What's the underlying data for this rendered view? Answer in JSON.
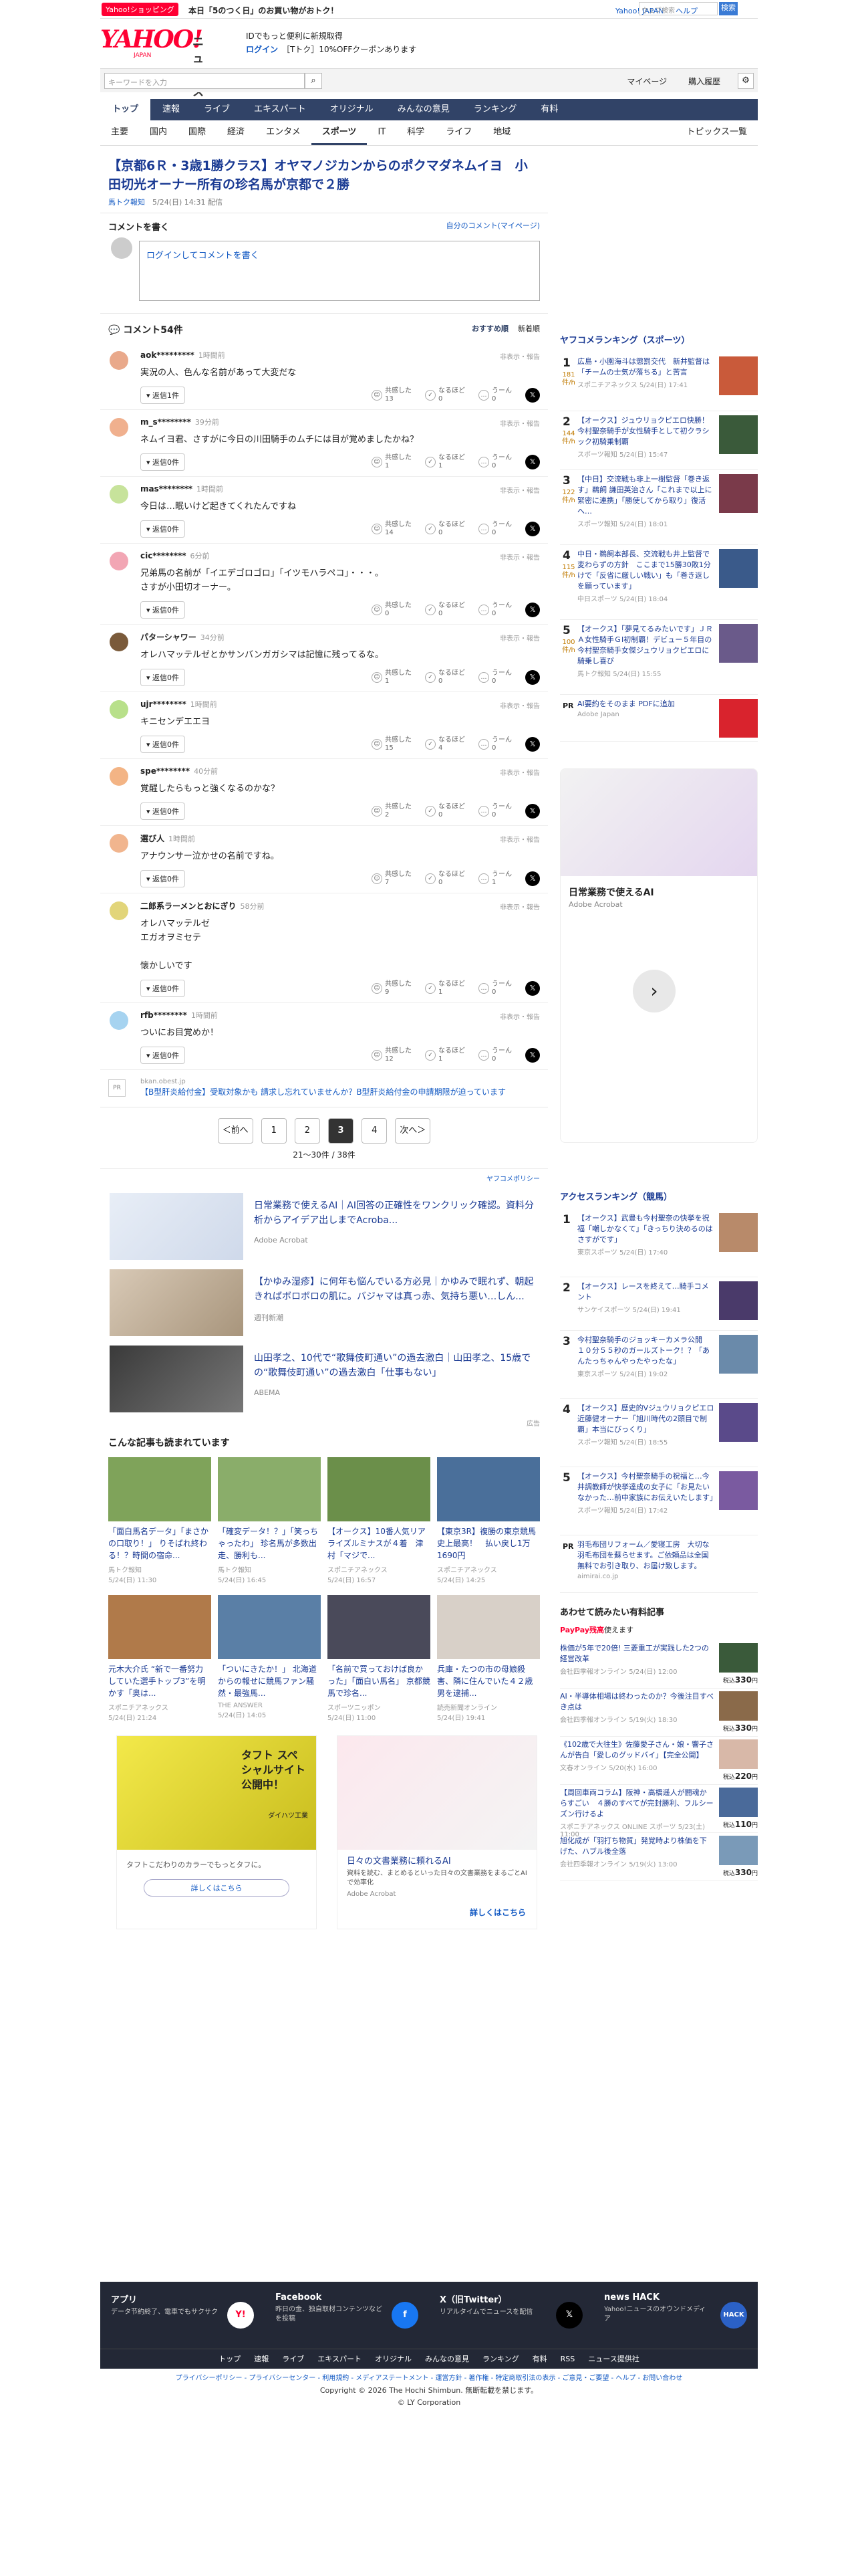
{
  "top": {
    "shopping_badge": "Yahoo!ショッピング",
    "promo": "本日「5のつく日」のお買い物がおトク！",
    "links": [
      "Yahoo! JAPAN",
      "ヘルプ"
    ],
    "web_search_placeholder": "ウェブ検索",
    "web_search_button": "検索"
  },
  "logo": {
    "yahoo": "YAHOO!",
    "japan": "JAPAN",
    "news": "ニュース"
  },
  "login": {
    "line1": "IDでもっと便利に新規取得",
    "line2_login": "ログイン",
    "line2_rest": "［Tトク］10%OFFクーポンあります"
  },
  "search": {
    "placeholder": "キーワードを入力",
    "mypage": "マイページ",
    "purchase": "購入履歴"
  },
  "gnav": [
    "トップ",
    "速報",
    "ライブ",
    "エキスパート",
    "オリジナル",
    "みんなの意見",
    "ランキング",
    "有料"
  ],
  "snav": [
    "主要",
    "国内",
    "国際",
    "経済",
    "エンタメ",
    "スポーツ",
    "IT",
    "科学",
    "ライフ",
    "地域"
  ],
  "snav_topics": "トピックス一覧",
  "article": {
    "title": "【京都6Ｒ・3歳1勝クラス】オヤマノジカンからのポクマダネムイヨ　小田切光オーナー所有の珍名馬が京都で２勝",
    "source": "馬トク報知",
    "date": "5/24(日) 14:31 配信"
  },
  "comment_write": {
    "heading": "コメントを書く",
    "mine": "自分のコメント(マイページ)",
    "login_link": "ログイン",
    "prompt": "してコメントを書く"
  },
  "comments_header": {
    "count": "コメント54件",
    "sort_recommended": "おすすめ順",
    "sort_new": "新着順"
  },
  "comments": [
    {
      "user": "aok*********",
      "time": "1時間前",
      "text": "実況の人、色んな名前があって大変だな",
      "replies": "返信1件",
      "empathy": "13",
      "naruhodo": "0",
      "umu": "0"
    },
    {
      "user": "m_s********",
      "time": "39分前",
      "text": "ネムイヨ君、さすがに今日の川田騎手のムチには目が覚めましたかね？",
      "replies": "返信0件",
      "empathy": "1",
      "naruhodo": "1",
      "umu": "0"
    },
    {
      "user": "mas********",
      "time": "1時間前",
      "text": "今日は…眠いけど起きてくれたんですね",
      "replies": "返信0件",
      "empathy": "14",
      "naruhodo": "0",
      "umu": "0"
    },
    {
      "user": "cic********",
      "time": "6分前",
      "text": "兄弟馬の名前が「イエデゴロゴロ」「イツモハラペコ」・・・。\nさすが小田切オーナー。",
      "replies": "返信0件",
      "empathy": "0",
      "naruhodo": "0",
      "umu": "0"
    },
    {
      "user": "パターシャワー",
      "time": "34分前",
      "text": "オレハマッテルゼとかサンバンガガシマは記憶に残ってるな。",
      "replies": "返信0件",
      "empathy": "1",
      "naruhodo": "0",
      "umu": "0"
    },
    {
      "user": "ujr********",
      "time": "1時間前",
      "text": "キニセンデエエヨ",
      "replies": "返信0件",
      "empathy": "15",
      "naruhodo": "4",
      "umu": "0"
    },
    {
      "user": "spe********",
      "time": "40分前",
      "text": "覚醒したらもっと強くなるのかな？",
      "replies": "返信0件",
      "empathy": "2",
      "naruhodo": "0",
      "umu": "0"
    },
    {
      "user": "選び人",
      "time": "1時間前",
      "text": "アナウンサー泣かせの名前ですね。",
      "replies": "返信0件",
      "empathy": "7",
      "naruhodo": "0",
      "umu": "1"
    },
    {
      "user": "二郎系ラーメンとおにぎり",
      "time": "58分前",
      "text": "オレハマッテルゼ\nエガオヲミセテ\n\n懐かしいです",
      "replies": "返信0件",
      "empathy": "9",
      "naruhodo": "1",
      "umu": "0"
    },
    {
      "user": "rfb********",
      "time": "1時間前",
      "text": "ついにお目覚めか！",
      "replies": "返信0件",
      "empathy": "12",
      "naruhodo": "1",
      "umu": "0"
    }
  ],
  "comment_labels": {
    "report": "非表示・報告",
    "empathy": "共感した",
    "naruhodo": "なるほど",
    "umu": "うーん"
  },
  "ad_text": {
    "pr": "PR",
    "domain": "bkan.obest.jp",
    "message": "【B型肝炎給付金】受取対象かも 請求し忘れていませんか？B型肝炎給付金の申請期限が迫っています"
  },
  "pager": {
    "prev": "＜前へ",
    "pages": [
      "1",
      "2",
      "3",
      "4"
    ],
    "current": "3",
    "next": "次へ＞",
    "count": "21〜30件 / 38件"
  },
  "native_ads": {
    "policy": "ヤフコメポリシー",
    "items": [
      {
        "title": "日常業務で使えるAI｜AI回答の正確性をワンクリック確認。資料分析からアイデア出しまでAcroba...",
        "sponsor": "Adobe Acrobat"
      },
      {
        "title": "【かゆみ湿疹】に何年も悩んでいる方必見｜かゆみで眠れず、朝起きればボロボロの肌に。バジャマは真っ赤、気持ち悪い…しん...",
        "sponsor": "週刊新潮"
      },
      {
        "title": "山田孝之、10代で“歌舞伎町通い”の過去激白｜山田孝之、15歳での“歌舞伎町通い”の過去激白「仕事もない」",
        "sponsor": "ABEMA"
      }
    ]
  },
  "related": {
    "heading": "こんな記事も読まれています",
    "items": [
      {
        "title": "「面白馬名データ」「まさかの口取り！」 りそばれ終わる！？時間の宿命...",
        "source": "馬トク報知",
        "date": "5/24(日) 11:30"
      },
      {
        "title": "「確変データ！？」「笑っちゃったわ」 珍名馬が多数出走、勝利も...",
        "source": "馬トク報知",
        "date": "5/24(日) 16:45"
      },
      {
        "title": "【オークス】10番人気リアライズルミナスが４着　津村「マジで...",
        "source": "スポニチアネックス",
        "date": "5/24(日) 16:57"
      },
      {
        "title": "【東京3R】複勝の東京競馬史上最高！　払い戻し1万1690円",
        "source": "スポニチアネックス",
        "date": "5/24(日) 14:25"
      },
      {
        "title": "元木大介氏 “新で一番努力していた選手トップ3”を明かす「奥は...",
        "source": "スポニチアネックス",
        "date": "5/24(日) 21:24"
      },
      {
        "title": "「ついにきたか！」 北海道からの報せに競馬ファン騒然・最強馬...",
        "source": "THE ANSWER",
        "date": "5/24(日) 14:05"
      },
      {
        "title": "「名前で買っておけば良かった」「面白い馬名」 京都競馬で珍名...",
        "source": "スポーツニッポン",
        "date": "5/24(日) 11:00"
      },
      {
        "title": "兵庫・たつの市の母娘殺害、隣に住んでいた４２歳男を逮捕...",
        "source": "読売新聞オンライン",
        "date": "5/24(日) 19:41"
      }
    ]
  },
  "bottom_ads": [
    {
      "title": "タフト スペシャルサイト公開中！",
      "brand": "ダイハツ工業",
      "desc": "タフトこだわりのカラーでもっとタフに。",
      "cta": "詳しくはこちら"
    },
    {
      "title": "日々の文書業務に頼れるAI",
      "desc": "資料を読む、まとめるといった日々の文書業務をまるごとAIで効率化",
      "sponsor": "Adobe Acrobat",
      "cta": "詳しくはこちら"
    }
  ],
  "sponsored_label": "広告",
  "sidebar": {
    "ranking_heading": "ヤフコメランキング（スポーツ）",
    "ranking": [
      {
        "rank": "1",
        "comments": "181",
        "title": "広島・小園海斗は懲罰交代　新井監督は「チームの士気が落ちる」と苦言",
        "source": "スポニチアネックス",
        "date": "5/24(日) 17:41"
      },
      {
        "rank": "2",
        "comments": "144",
        "title": "【オークス】ジュウリョクピエロ快勝！今村聖奈騎手が女性騎手として初クラシック初騎乗制覇",
        "source": "スポーツ報知",
        "date": "5/24(日) 15:47"
      },
      {
        "rank": "3",
        "comments": "122",
        "title": "【中日】交流戦も非上一樹監督「巻き返す」鵜飼 謙田英治さん「これまで以上に緊密に連携」「勝使してから取り」復活へ…",
        "source": "スポーツ報知",
        "date": "5/24(日) 18:01"
      },
      {
        "rank": "4",
        "comments": "115",
        "title": "中日・鵜飼本部長、交流戦も井上監督で変わらずの方針　ここまで15勝30敗1分けで「反省に厳しい戦い」も「巻き返しを願っています」",
        "source": "中日スポーツ",
        "date": "5/24(日) 18:04"
      },
      {
        "rank": "5",
        "comments": "100",
        "title": "【オークス】「夢見てるみたいです」ＪＲＡ女性騎手ＧⅠ初制覇！デビュー５年目の今村聖奈騎手女傑ジュウリョクピエロに騎乗し喜び",
        "source": "馬トク報知",
        "date": "5/24(日) 15:55"
      }
    ],
    "ranking_unit": "件/h",
    "pr_text": "AI要約をそのまま PDFに追加",
    "pr_sponsor": "Adobe Japan",
    "ad_headline": "日常業務で使えるAI",
    "ad_brand": "Adobe Acrobat",
    "access_heading": "アクセスランキング（競馬）",
    "access": [
      {
        "rank": "1",
        "title": "【オークス】武豊も今村聖奈の快挙を祝福「嘲しかなくて」「きっちり決めるのはさすがです」",
        "source": "東京スポーツ",
        "date": "5/24(日) 17:40"
      },
      {
        "rank": "2",
        "title": "【オークス】レースを終えて…騎手コメント",
        "source": "サンケイスポーツ",
        "date": "5/24(日) 19:41"
      },
      {
        "rank": "3",
        "title": "今村聖奈騎手のジョッキーカメラ公開　１０分５５秒のガールズトーク！？「あんたっちゃんやったやったな」",
        "source": "東京スポーツ",
        "date": "5/24(日) 19:02"
      },
      {
        "rank": "4",
        "title": "【オークス】歴史的Vジュウリョクピエロ　近藤健オーナー「旭川時代の2頭目で制覇」本当にびっくり」",
        "source": "スポーツ報知",
        "date": "5/24(日) 18:55"
      },
      {
        "rank": "5",
        "title": "【オークス】今村聖奈騎手の祝福と…今井調教師が快挙達成の女子に「お見たいなかった…前中家族にお伝えいたします」",
        "source": "スポーツ報知",
        "date": "5/24(日) 17:42"
      }
    ],
    "access_pr": "羽毛布団リフォーム／愛寝工房　大切な羽毛布団を蘇らせます。ご依頼品は全国無料でお引き取り、お届け致します。",
    "access_pr_domain": "aimirai.co.jp",
    "paid_heading": "あわせて読みたい有料記事",
    "paid_brand": "PayPay残高",
    "paid_brand_rest": "使えます",
    "paid": [
      {
        "title": "株価が5年で20倍! 三菱重工が実践した2つの経営改革",
        "source": "会社四季報オンライン",
        "date": "5/24(日) 12:00",
        "price": "330"
      },
      {
        "title": "AI・半導体相場は終わったのか？今後注目すべき点は",
        "source": "会社四季報オンライン",
        "date": "5/19(火) 18:30",
        "price": "330"
      },
      {
        "title": "《102歳で大往生》佐藤愛子さん・娘・響子さんが告白「愛しのグッドバイ」【完全公開】",
        "source": "文春オンライン",
        "date": "5/20(水) 16:00",
        "price": "220"
      },
      {
        "title": "【周回車両コラム】阪神・高橋遥人が闘魂からすごい　４勝のすべてが完封勝利、フルシーズン行けるよ",
        "source": "スポニチアネックス ONLINE スポーツ",
        "date": "5/23(土) 11:00",
        "price": "110"
      },
      {
        "title": "旭化成が「羽打ち物質」発覚時より株価を下げた、ハブル後全落",
        "source": "会社四季報オンライン",
        "date": "5/19(火) 13:00",
        "price": "330"
      }
    ],
    "paid_tax": "税込",
    "paid_yen": "円"
  },
  "footer": [
    {
      "title": "アプリ",
      "desc": "データ节約終了、電車でもサクサク"
    },
    {
      "title": "Facebook",
      "desc": "昨日の金、独自取材コンテンツなどを投稿"
    },
    {
      "title": "X（旧Twitter）",
      "desc": "リアルタイムでニュースを配信"
    },
    {
      "title": "news HACK",
      "desc": "Yahoo!ニュースのオウンドメディア"
    }
  ],
  "footer_nav": [
    "トップ",
    "速報",
    "ライブ",
    "エキスパート",
    "オリジナル",
    "みんなの意見",
    "ランキング",
    "有料",
    "RSS",
    "ニュース提供社"
  ],
  "footer_links": "プライバシーポリシー - プライバシーセンター - 利用規約 - メディアステートメント - 運営方針 - 著作権 - 特定商取引法の表示 - ご意見・ご要望 - ヘルプ - お問い合わせ",
  "copyright1": "Copyright © 2026 The Hochi Shimbun. 無断転載を禁じます。",
  "copyright2": "© LY Corporation",
  "colors": {
    "brand": "#ff0033",
    "nav": "#314367",
    "link": "#1a3a93"
  }
}
